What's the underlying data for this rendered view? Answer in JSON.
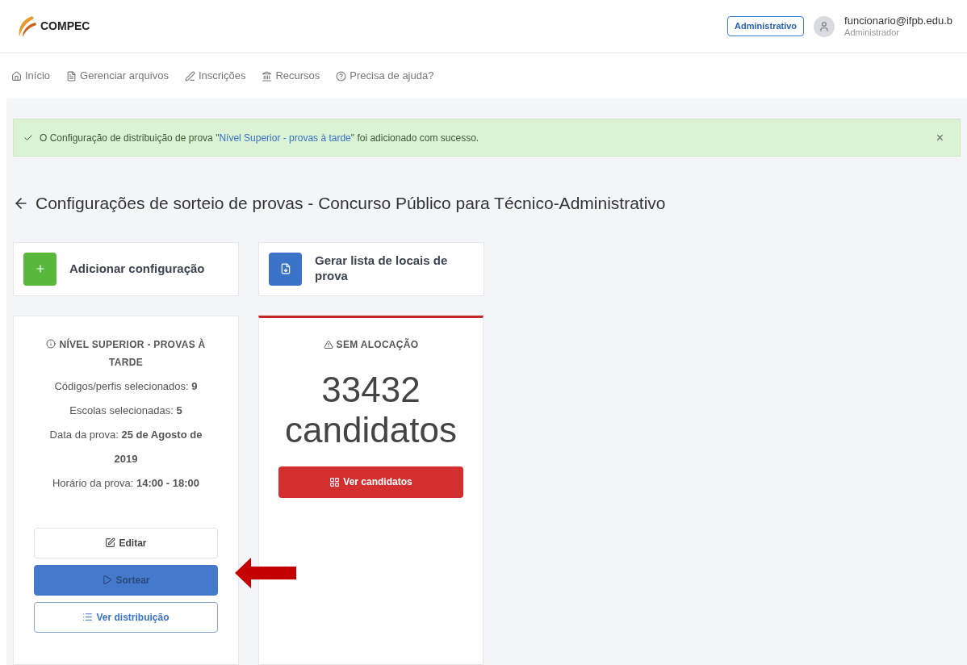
{
  "header": {
    "logo": "COMPEC",
    "role_badge": "Administrativo",
    "user": {
      "email": "funcionario@ifpb.edu.b",
      "role": "Administrador"
    }
  },
  "nav": [
    {
      "label": "Início"
    },
    {
      "label": "Gerenciar arquivos"
    },
    {
      "label": "Inscrições"
    },
    {
      "label": "Recursos"
    },
    {
      "label": "Precisa de ajuda?"
    }
  ],
  "alert": {
    "before": "O Configuração de distribuição de prova \"",
    "link": "Nível Superior - provas à tarde",
    "after": "\" foi adicionado com sucesso.",
    "close": "×"
  },
  "page_title": "Configurações de sorteio de provas - Concurso Público para Técnico-Administrativo",
  "actions": [
    {
      "label": "Adicionar configuração",
      "kind": "add"
    },
    {
      "label": "Gerar lista de locais de prova",
      "kind": "pdf"
    }
  ],
  "config_card": {
    "title": "NÍVEL SUPERIOR - PROVAS À TARDE",
    "lines": [
      "Códigos/perfis selecionados: **9**",
      "Escolas selecionadas: **5**",
      "Data da prova: **25 de Agosto de 2019**",
      "Horário da prova: **14:00 - 18:00**"
    ],
    "buttons": [
      {
        "label": "Editar",
        "kind": "edit"
      },
      {
        "label": "Sortear",
        "kind": "draw"
      },
      {
        "label": "Ver distribuição",
        "kind": "list"
      }
    ]
  },
  "status_card": {
    "title": "SEM ALOCAÇÃO",
    "count": "33432",
    "unit": "candidatos",
    "button": "Ver candidatos"
  }
}
